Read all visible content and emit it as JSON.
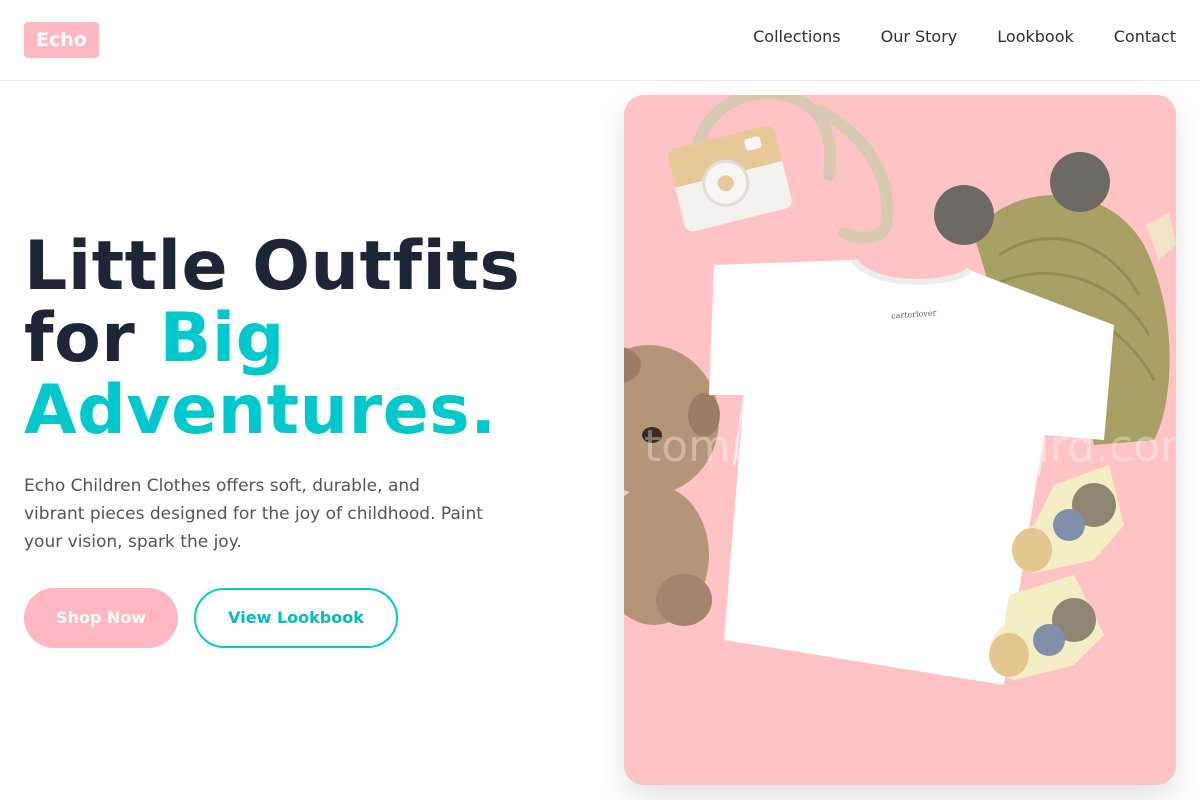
{
  "brand": {
    "logo_text": "Echo"
  },
  "nav": {
    "items": [
      "Collections",
      "Our Story",
      "Lookbook",
      "Contact"
    ]
  },
  "hero": {
    "headline_line1": "Little Outfits",
    "headline_for": "for ",
    "headline_accent": "Big",
    "headline_line3": "Adventures.",
    "description": "Echo Children Clothes offers soft, durable, and vibrant pieces designed for the joy of childhood. Paint your vision, spark the joy.",
    "primary_cta": "Shop Now",
    "secondary_cta": "View Lookbook"
  },
  "image": {
    "tag_text": "carterlover",
    "watermark": "tommyhummingbird.com"
  },
  "colors": {
    "brand_pink": "#ffb7c1",
    "accent_cyan": "#00c8cc",
    "heading_dark": "#1c2637",
    "photo_background": "#ffc4c6"
  }
}
